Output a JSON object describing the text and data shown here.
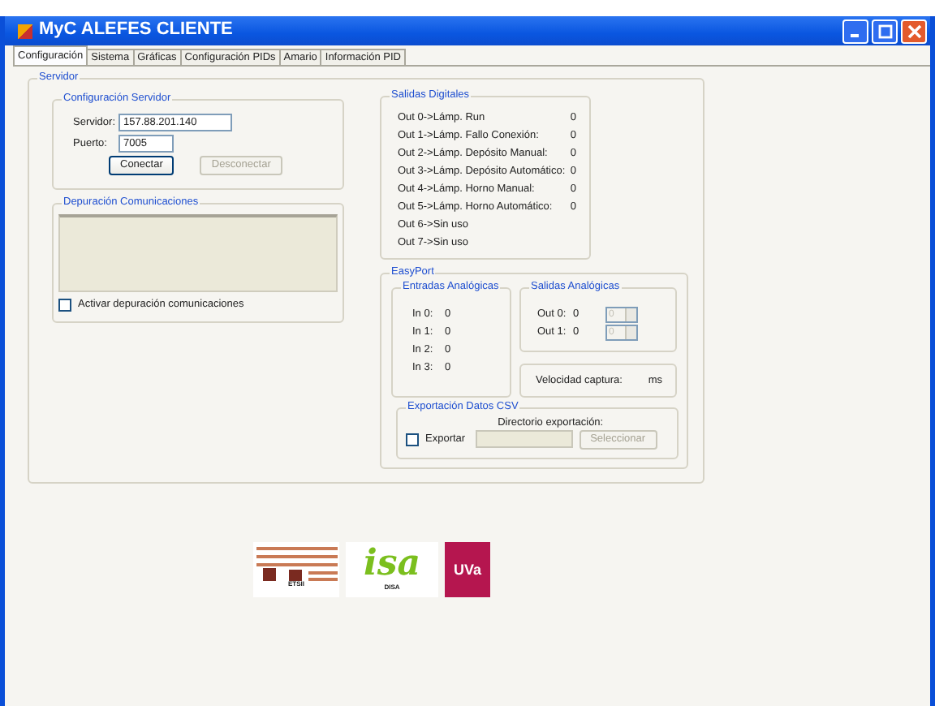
{
  "window": {
    "title": "MyC ALEFES CLIENTE"
  },
  "tabs": [
    {
      "label": "Configuración",
      "selected": true
    },
    {
      "label": "Sistema",
      "selected": false
    },
    {
      "label": "Gráficas",
      "selected": false
    },
    {
      "label": "Configuración PIDs",
      "selected": false
    },
    {
      "label": "Amario",
      "selected": false
    },
    {
      "label": "Información PID",
      "selected": false
    }
  ],
  "servidor": {
    "title": "Servidor",
    "config": {
      "title": "Configuración Servidor",
      "fields": [
        {
          "label": "Servidor:",
          "value": "157.88.201.140"
        },
        {
          "label": "Puerto:",
          "value": "7005"
        }
      ],
      "buttons": [
        {
          "label": "Conectar",
          "disabled": false
        },
        {
          "label": "Desconectar",
          "disabled": true
        }
      ]
    },
    "debug": {
      "title": "Depuración Comunicaciones",
      "checkbox": {
        "label": "Activar depuración comunicaciones",
        "checked": false
      }
    },
    "digital_outputs": {
      "title": "Salidas Digitales",
      "rows": [
        {
          "label": "Out 0->Lámp. Run",
          "value": "0"
        },
        {
          "label": "Out 1->Lámp. Fallo Conexión:",
          "value": "0"
        },
        {
          "label": "Out 2->Lámp. Depósito Manual:",
          "value": "0"
        },
        {
          "label": "Out 3->Lámp. Depósito Automático:",
          "value": "0"
        },
        {
          "label": "Out 4->Lámp. Horno Manual:",
          "value": "0"
        },
        {
          "label": "Out 5->Lámp. Horno Automático:",
          "value": "0"
        },
        {
          "label": "Out 6->Sin uso"
        },
        {
          "label": "Out 7->Sin uso"
        }
      ]
    },
    "easyport": {
      "title": "EasyPort",
      "analog_inputs": {
        "title": "Entradas Analógicas",
        "rows": [
          {
            "label": "In 0:",
            "value": "0"
          },
          {
            "label": "In 1:",
            "value": "0"
          },
          {
            "label": "In 2:",
            "value": "0"
          },
          {
            "label": "In 3:",
            "value": "0"
          }
        ]
      },
      "analog_outputs": {
        "title": "Salidas Analógicas",
        "rows": [
          {
            "label": "Out 0:",
            "value": "0",
            "spinner": "0"
          },
          {
            "label": "Out 1:",
            "value": "0",
            "spinner": "0"
          }
        ]
      },
      "capture": {
        "label": "Velocidad captura:",
        "unit": "ms"
      },
      "csv": {
        "title": "Exportación Datos CSV",
        "checkbox": {
          "label": "Exportar",
          "checked": false
        },
        "directory_label": "Directorio exportación:",
        "button": {
          "label": "Seleccionar",
          "disabled": true
        }
      }
    }
  },
  "logos": [
    {
      "kind": "etsii",
      "caption": "ETSII"
    },
    {
      "kind": "isa",
      "text": "isa",
      "caption": "DISA"
    },
    {
      "kind": "uva",
      "text": "UVa"
    }
  ]
}
